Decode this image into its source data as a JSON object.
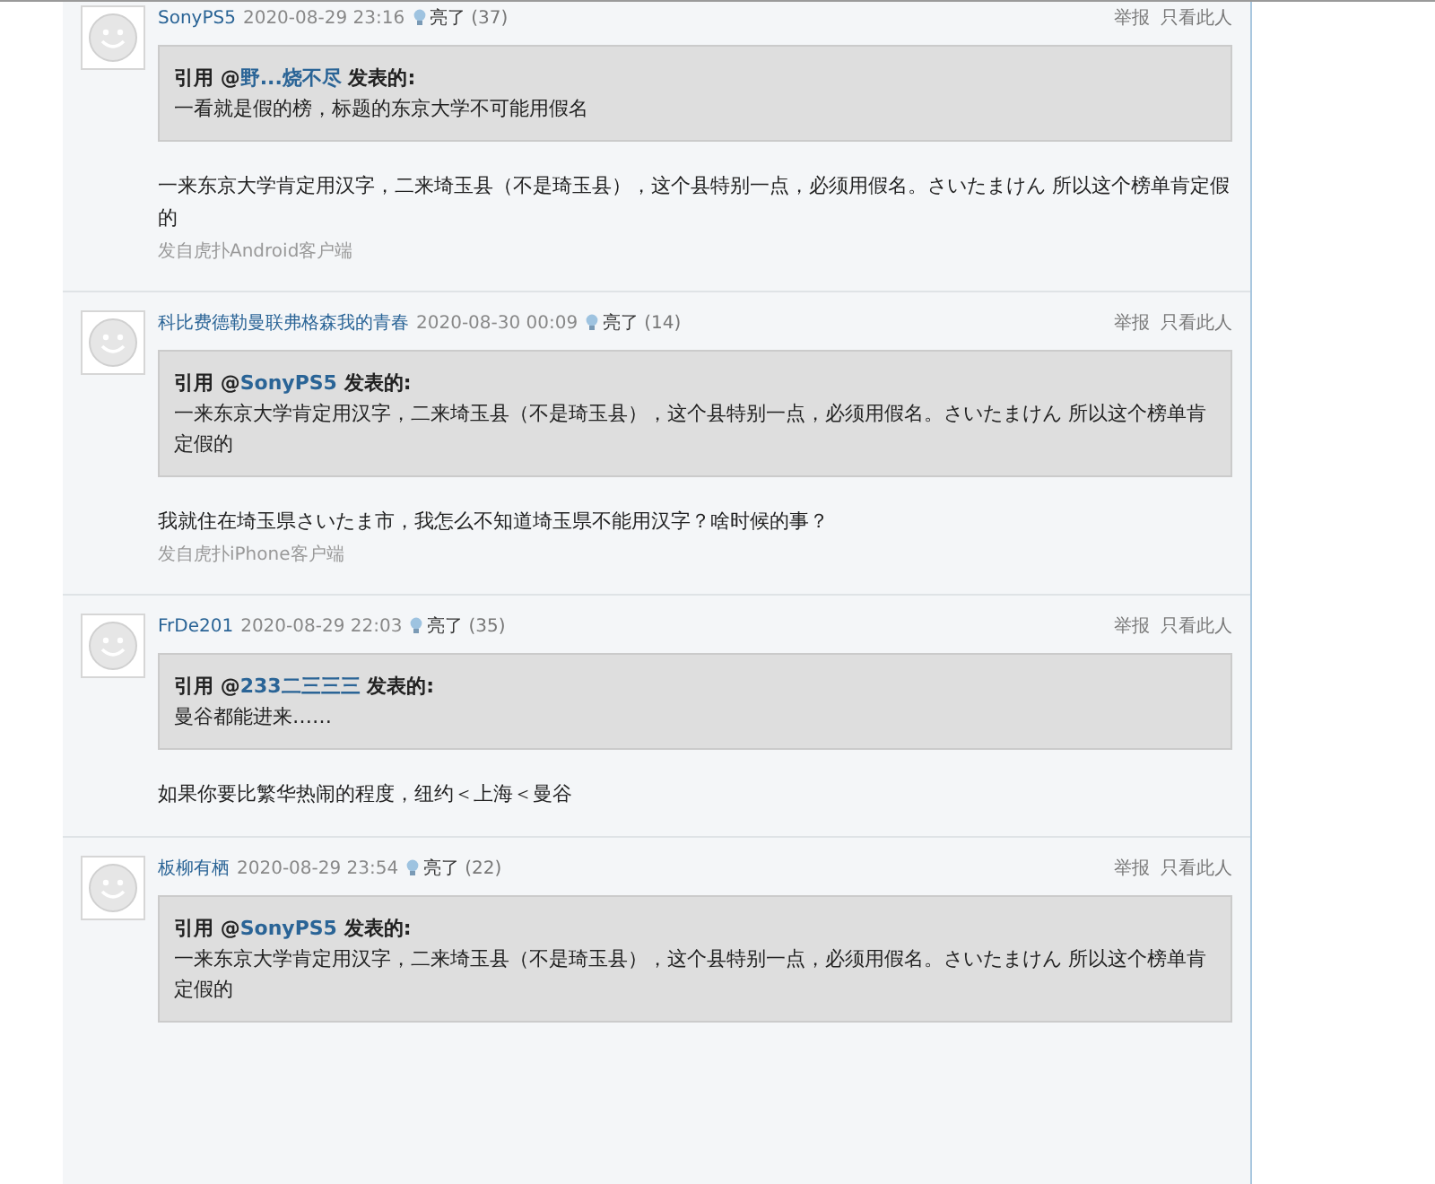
{
  "posts": [
    {
      "author": "SonyPS5",
      "time": "2020-08-29 23:16",
      "likes_label": "亮了",
      "likes_count": "(37)",
      "actions": [
        "举报",
        "只看此人"
      ],
      "quote": {
        "prefix": "引用 @",
        "user": "野...烧不尽",
        "suffix": "发表的:",
        "text": "一看就是假的榜，标题的东京大学不可能用假名"
      },
      "body": "一来东京大学肯定用汉字，二来埼玉县（不是琦玉县），这个县特别一点，必须用假名。さいたまけん 所以这个榜单肯定假的",
      "source": "发自虎扑Android客户端"
    },
    {
      "author": "科比费德勒曼联弗格森我的青春",
      "time": "2020-08-30 00:09",
      "likes_label": "亮了",
      "likes_count": "(14)",
      "actions": [
        "举报",
        "只看此人"
      ],
      "quote": {
        "prefix": "引用 @",
        "user": "SonyPS5",
        "suffix": "发表的:",
        "text": "一来东京大学肯定用汉字，二来埼玉县（不是琦玉县），这个县特别一点，必须用假名。さいたまけん 所以这个榜单肯定假的"
      },
      "body": "我就住在埼玉県さいたま市，我怎么不知道埼玉県不能用汉字？啥时候的事？",
      "source": "发自虎扑iPhone客户端"
    },
    {
      "author": "FrDe201",
      "time": "2020-08-29 22:03",
      "likes_label": "亮了",
      "likes_count": "(35)",
      "actions": [
        "举报",
        "只看此人"
      ],
      "quote": {
        "prefix": "引用 @",
        "user": "233二三三三",
        "suffix": "发表的:",
        "text": "曼谷都能进来……"
      },
      "body": "如果你要比繁华热闹的程度，纽约＜上海＜曼谷"
    },
    {
      "author": "板柳有栖",
      "time": "2020-08-29 23:54",
      "likes_label": "亮了",
      "likes_count": "(22)",
      "actions": [
        "举报",
        "只看此人"
      ],
      "quote": {
        "prefix": "引用 @",
        "user": "SonyPS5",
        "suffix": "发表的:",
        "text": "一来东京大学肯定用汉字，二来埼玉县（不是琦玉县），这个县特别一点，必须用假名。さいたまけん 所以这个榜单肯定假的"
      }
    }
  ]
}
